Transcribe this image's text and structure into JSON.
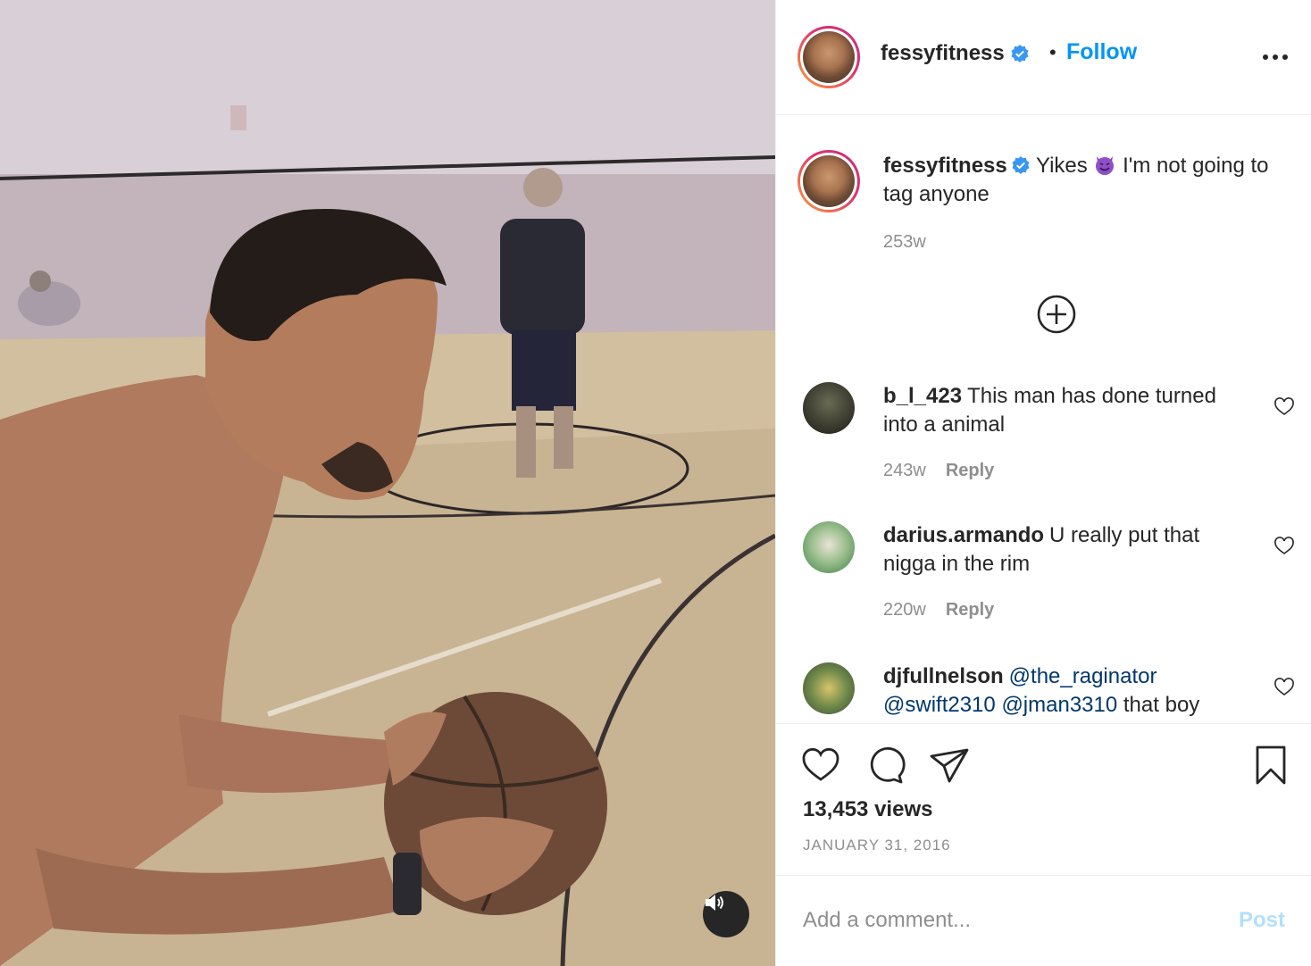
{
  "post": {
    "username": "fessyfitness",
    "verified": true,
    "separator": "•",
    "follow_label": "Follow",
    "more_icon": "more-horizontal-icon"
  },
  "caption": {
    "username": "fessyfitness",
    "text_before_emoji": "Yikes",
    "emoji": "smiling-devil-emoji",
    "text_after_emoji": "I'm not going to tag anyone",
    "time": "253w"
  },
  "load_more_icon": "plus-circle-icon",
  "comments": [
    {
      "username": "b_l_423",
      "text": "This man has done turned into a animal",
      "time": "243w",
      "reply": "Reply"
    },
    {
      "username": "darius.armando",
      "text": "U really put that nigga in the rim",
      "time": "220w",
      "reply": "Reply"
    },
    {
      "username": "djfullnelson",
      "mentions": [
        "@the_raginator",
        "@swift2310",
        "@jman3310"
      ],
      "text": "that boy",
      "time": "",
      "reply": ""
    }
  ],
  "actions": {
    "icons": [
      "heart-icon",
      "comment-icon",
      "share-icon",
      "bookmark-icon"
    ],
    "views": "13,453 views",
    "date": "JANUARY 31, 2016"
  },
  "add_comment": {
    "placeholder": "Add a comment...",
    "post_label": "Post"
  },
  "colors": {
    "link_blue": "#0095f6",
    "post_disabled": "#b2dffc",
    "secondary_text": "#8e8e8e",
    "verified_blue": "#3897f0"
  }
}
